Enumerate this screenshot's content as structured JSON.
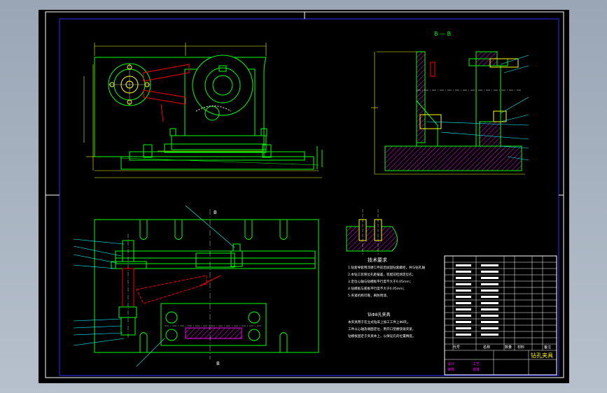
{
  "colors": {
    "background": "#000000",
    "frame": "#ffffff",
    "part_outline": "#00ff00",
    "dimension": "#ffff00",
    "hatch": "#ff00ff",
    "callout": "#00ffff",
    "hidden_edge": "#ff0000",
    "border_inner": "#0000ff"
  },
  "views": {
    "top_view_icon": "drill-jig-top-view",
    "side_view_icon": "drill-jig-side-section",
    "plan_view_icon": "drill-jig-plan-view",
    "detail_view_icon": "bushing-detail-section"
  },
  "section_label": "B — B",
  "section_marker_left": "B",
  "section_marker_bottom": "B",
  "notes_title": "技术要求",
  "notes_lines": [
    "1.钻套导套用淬硬工件前后加固钻套螺栓，并与钻孔轴",
    "2.本钻工装限位孔距偏差，装配前检测定位孔；",
    "3.定位心轴与钻模板平行度不大于0.05mm；",
    "4.钻模板与底板平行度不大于0.05mm；",
    "5.夹紧机构可靠，刷防锈漆。"
  ],
  "fixture_heading": "钻Φ8孔夹具",
  "fixture_desc": [
    "本夹具用于在立式钻床上加工工件上Φ8孔，",
    "工件以心轴及端面定位，用开口垫圈快速夹紧，",
    "钻模板固定于夹具体上，以保证孔的位置精度。"
  ],
  "title_block": {
    "drawing_name": "钻孔夹具",
    "header_cells": [
      "代号",
      "名称",
      "数量",
      "材料",
      "备注"
    ],
    "bottom_rows": [
      "设计",
      "审核",
      "工艺",
      "批准"
    ]
  }
}
